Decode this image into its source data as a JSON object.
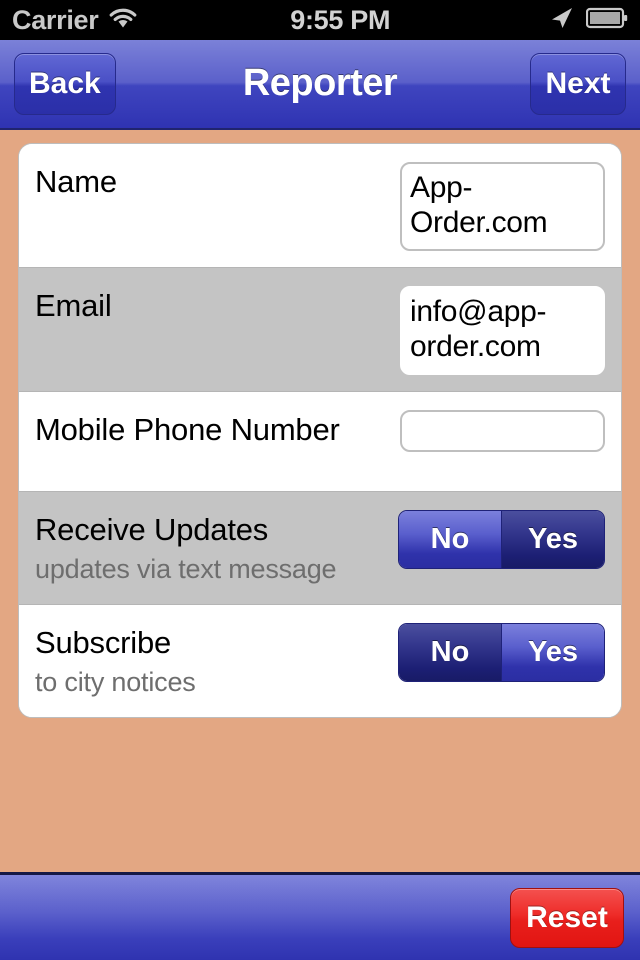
{
  "status_bar": {
    "carrier": "Carrier",
    "time": "9:55 PM",
    "wifi_icon": "wifi-icon",
    "location_icon": "location-arrow-icon",
    "battery_icon": "battery-icon"
  },
  "nav_bar": {
    "back_label": "Back",
    "title": "Reporter",
    "next_label": "Next"
  },
  "form": {
    "rows": [
      {
        "title": "Name",
        "subtitle": "",
        "control": "text",
        "value": "App-Order.com",
        "placeholder": ""
      },
      {
        "title": "Email",
        "subtitle": "",
        "control": "text",
        "value": "info@app-order.com",
        "placeholder": ""
      },
      {
        "title": "Mobile Phone Number",
        "subtitle": "",
        "control": "text",
        "value": "",
        "placeholder": ""
      },
      {
        "title": "Receive Updates",
        "subtitle": "updates via text message",
        "control": "segmented",
        "options": [
          "No",
          "Yes"
        ],
        "selected": "Yes"
      },
      {
        "title": "Subscribe",
        "subtitle": "to city notices",
        "control": "segmented",
        "options": [
          "No",
          "Yes"
        ],
        "selected": "No"
      }
    ]
  },
  "toolbar": {
    "reset_label": "Reset"
  },
  "colors": {
    "background": "#e3a783",
    "nav_blue": "#4a50c6",
    "row_gray": "#c4c4c4",
    "row_white": "#ffffff",
    "reset_red": "#ee2b28",
    "segment_selected": "#1c1f74",
    "segment_unselected": "#5a5fcd"
  }
}
